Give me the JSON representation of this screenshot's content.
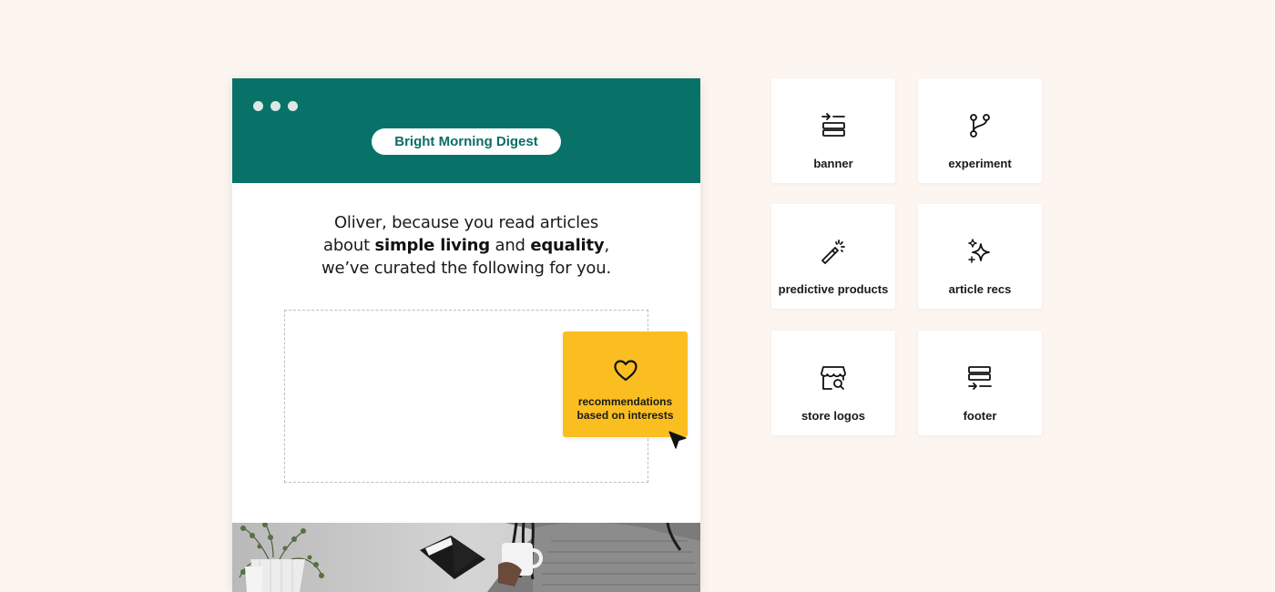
{
  "email": {
    "brand": "Bright Morning Digest",
    "greeting": {
      "line1": "Oliver, because you read articles",
      "about": "about",
      "interest1": "simple living",
      "and": "and",
      "interest2": "equality",
      "comma": ",",
      "line3": "we’ve curated the following for you."
    }
  },
  "drag_block": {
    "icon": "heart-icon",
    "label_line1": "recommendations",
    "label_line2": "based on interests"
  },
  "palette": {
    "items": [
      {
        "label": "banner",
        "icon": "banner-icon"
      },
      {
        "label": "experiment",
        "icon": "branch-icon"
      },
      {
        "label": "predictive products",
        "icon": "magic-wand-icon"
      },
      {
        "label": "article recs",
        "icon": "sparkles-icon"
      },
      {
        "label": "store logos",
        "icon": "store-search-icon"
      },
      {
        "label": "footer",
        "icon": "footer-icon"
      }
    ]
  },
  "colors": {
    "background": "#fdf5f0",
    "header": "#087268",
    "accent": "#fbbe21"
  }
}
